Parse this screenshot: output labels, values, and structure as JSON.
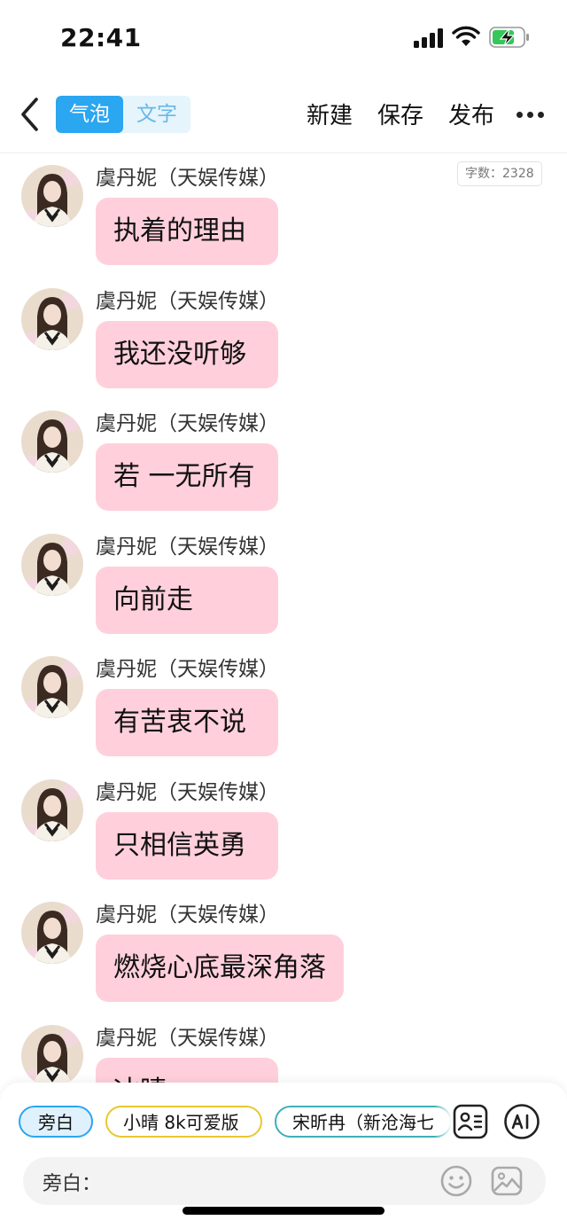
{
  "status_bar": {
    "time": "22:41"
  },
  "nav": {
    "tabs": [
      {
        "label": "气泡",
        "active": true
      },
      {
        "label": "文字",
        "active": false
      }
    ],
    "actions": {
      "new": "新建",
      "save": "保存",
      "publish": "发布"
    }
  },
  "chat": {
    "word_count": "字数：2328",
    "messages": [
      {
        "sender": "虞丹妮（天娱传媒）",
        "text": "执着的理由"
      },
      {
        "sender": "虞丹妮（天娱传媒）",
        "text": "我还没听够"
      },
      {
        "sender": "虞丹妮（天娱传媒）",
        "text": "若 一无所有"
      },
      {
        "sender": "虞丹妮（天娱传媒）",
        "text": "向前走"
      },
      {
        "sender": "虞丹妮（天娱传媒）",
        "text": "有苦衷不说"
      },
      {
        "sender": "虞丹妮（天娱传媒）",
        "text": "只相信英勇"
      },
      {
        "sender": "虞丹妮（天娱传媒）",
        "text": "燃烧心底最深角落"
      },
      {
        "sender": "虞丹妮（天娱传媒）",
        "text": "冰晴"
      }
    ]
  },
  "bottom": {
    "roles": [
      {
        "label": "旁白",
        "selected": true
      },
      {
        "label": "小晴 8k可爱版",
        "selected": false
      },
      {
        "label": "宋昕冉（新沧海七",
        "selected": false
      }
    ],
    "input": {
      "label": "旁白：",
      "value": ""
    },
    "icons": [
      "contact-card-icon",
      "ai-icon",
      "emoji-icon",
      "image-icon"
    ]
  },
  "colors": {
    "accent_blue": "#2ba6f0",
    "bubble_pink": "#ffd0dc",
    "chip_yellow": "#e9c72f",
    "chip_teal": "#3db0b7"
  }
}
